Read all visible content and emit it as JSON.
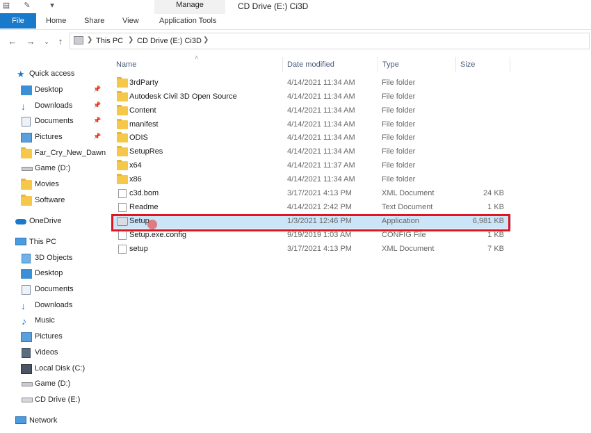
{
  "window": {
    "title": "CD Drive (E:) Ci3D",
    "context_tab": "Manage"
  },
  "ribbon": {
    "tabs": [
      "File",
      "Home",
      "Share",
      "View",
      "Application Tools"
    ]
  },
  "address": {
    "crumbs": [
      "This PC",
      "CD Drive (E:) Ci3D"
    ]
  },
  "nav": {
    "quick_access": "Quick access",
    "quick_items": [
      {
        "label": "Desktop",
        "icon": "desktop-icon",
        "pinned": true
      },
      {
        "label": "Downloads",
        "icon": "download-icon",
        "pinned": true
      },
      {
        "label": "Documents",
        "icon": "documents-icon",
        "pinned": true
      },
      {
        "label": "Pictures",
        "icon": "pictures-icon",
        "pinned": true
      },
      {
        "label": "Far_Cry_New_Dawn",
        "icon": "folder-icon",
        "pinned": false
      },
      {
        "label": "Game (D:)",
        "icon": "drive-icon",
        "pinned": false
      },
      {
        "label": "Movies",
        "icon": "folder-icon",
        "pinned": false
      },
      {
        "label": "Software",
        "icon": "folder-icon",
        "pinned": false
      }
    ],
    "onedrive": "OneDrive",
    "this_pc": "This PC",
    "pc_items": [
      {
        "label": "3D Objects",
        "icon": "3d-objects-icon"
      },
      {
        "label": "Desktop",
        "icon": "desktop-icon"
      },
      {
        "label": "Documents",
        "icon": "documents-icon"
      },
      {
        "label": "Downloads",
        "icon": "download-icon"
      },
      {
        "label": "Music",
        "icon": "music-icon"
      },
      {
        "label": "Pictures",
        "icon": "pictures-icon"
      },
      {
        "label": "Videos",
        "icon": "videos-icon"
      },
      {
        "label": "Local Disk (C:)",
        "icon": "drive-icon"
      },
      {
        "label": "Game (D:)",
        "icon": "drive-icon"
      },
      {
        "label": "CD Drive (E:)",
        "icon": "cd-drive-icon"
      }
    ],
    "network": "Network"
  },
  "columns": {
    "name": "Name",
    "date": "Date modified",
    "type": "Type",
    "size": "Size"
  },
  "files": [
    {
      "name": "3rdParty",
      "date": "4/14/2021 11:34 AM",
      "type": "File folder",
      "size": "",
      "icon": "folder"
    },
    {
      "name": "Autodesk Civil 3D Open Source",
      "date": "4/14/2021 11:34 AM",
      "type": "File folder",
      "size": "",
      "icon": "folder"
    },
    {
      "name": "Content",
      "date": "4/14/2021 11:34 AM",
      "type": "File folder",
      "size": "",
      "icon": "folder"
    },
    {
      "name": "manifest",
      "date": "4/14/2021 11:34 AM",
      "type": "File folder",
      "size": "",
      "icon": "folder"
    },
    {
      "name": "ODIS",
      "date": "4/14/2021 11:34 AM",
      "type": "File folder",
      "size": "",
      "icon": "folder"
    },
    {
      "name": "SetupRes",
      "date": "4/14/2021 11:34 AM",
      "type": "File folder",
      "size": "",
      "icon": "folder"
    },
    {
      "name": "x64",
      "date": "4/14/2021 11:37 AM",
      "type": "File folder",
      "size": "",
      "icon": "folder"
    },
    {
      "name": "x86",
      "date": "4/14/2021 11:34 AM",
      "type": "File folder",
      "size": "",
      "icon": "folder"
    },
    {
      "name": "c3d.bom",
      "date": "3/17/2021 4:13 PM",
      "type": "XML Document",
      "size": "24 KB",
      "icon": "doc"
    },
    {
      "name": "Readme",
      "date": "4/14/2021 2:42 PM",
      "type": "Text Document",
      "size": "1 KB",
      "icon": "doc"
    },
    {
      "name": "Setup",
      "date": "1/3/2021 12:46 PM",
      "type": "Application",
      "size": "6,981 KB",
      "icon": "app",
      "selected": true
    },
    {
      "name": "Setup.exe.config",
      "date": "9/19/2019 1:03 AM",
      "type": "CONFIG File",
      "size": "1 KB",
      "icon": "doc"
    },
    {
      "name": "setup",
      "date": "3/17/2021 4:13 PM",
      "type": "XML Document",
      "size": "7 KB",
      "icon": "doc"
    }
  ],
  "colors": {
    "accent": "#1979ca",
    "selection": "#cce4f7",
    "highlight": "#e0161e",
    "folder": "#f5c84a"
  }
}
